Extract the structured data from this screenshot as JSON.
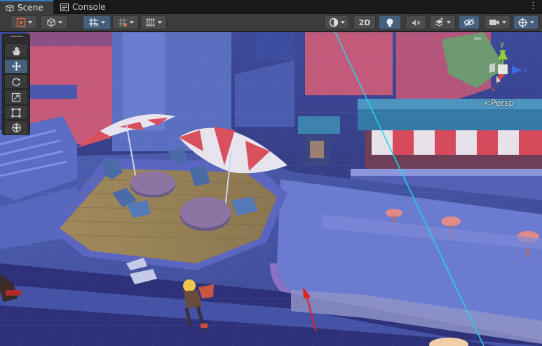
{
  "tabs": [
    {
      "label": "Scene",
      "icon": "grid-icon",
      "active": true
    },
    {
      "label": "Console",
      "icon": "console-icon",
      "active": false
    }
  ],
  "toolbar": {
    "two_d_label": "2D"
  },
  "palette": {
    "tools": [
      {
        "name": "hand-tool",
        "icon": "hand-icon",
        "active": false
      },
      {
        "name": "move-tool",
        "icon": "move-icon",
        "active": true
      },
      {
        "name": "rotate-tool",
        "icon": "rotate-icon",
        "active": false
      },
      {
        "name": "scale-tool",
        "icon": "scale-icon",
        "active": false
      },
      {
        "name": "rect-tool",
        "icon": "rect-icon",
        "active": false
      },
      {
        "name": "transform-tool",
        "icon": "transform-icon",
        "active": false
      }
    ]
  },
  "gizmo": {
    "y_label": "y",
    "z_label": "z",
    "x_label": "x",
    "projection_label": "Persp"
  },
  "colors": {
    "accent": "#3a79bb",
    "active_button": "#46607c",
    "panel": "#3c3c3c",
    "gizmo_y": "#8fd13c",
    "gizmo_z": "#3a6ee0",
    "gizmo_x": "#e0483a",
    "annotation_arrow": "#e21d1d",
    "cyan_line": "#19d8ea"
  }
}
